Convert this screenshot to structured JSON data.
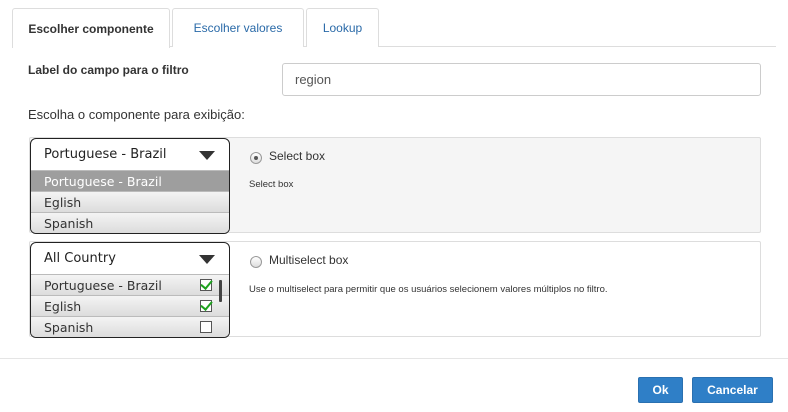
{
  "tabs": [
    {
      "label": "Escolher componente",
      "active": true
    },
    {
      "label": "Escolher valores",
      "active": false
    },
    {
      "label": "Lookup",
      "active": false
    }
  ],
  "filter_field": {
    "label": "Label do campo para o filtro",
    "value": "region"
  },
  "section_label": "Escolha o componente para exibição:",
  "select_box_option": {
    "title": "Select box",
    "description": "Select box",
    "selected": true,
    "preview": {
      "header": "Portuguese - Brazil",
      "items": [
        "Portuguese - Brazil",
        "Eglish",
        "Spanish"
      ],
      "highlighted_index": 0
    }
  },
  "multiselect_option": {
    "title": "Multiselect box",
    "description": "Use o multiselect para permitir que os usuários selecionem valores múltiplos no filtro.",
    "selected": false,
    "preview": {
      "header": "All Country",
      "items": [
        {
          "label": "Portuguese - Brazil",
          "checked": true
        },
        {
          "label": "Eglish",
          "checked": true
        },
        {
          "label": "Spanish",
          "checked": false
        }
      ]
    }
  },
  "buttons": {
    "ok": "Ok",
    "cancel": "Cancelar"
  },
  "colors": {
    "primary": "#2f7fc7",
    "link": "#2a6aa8",
    "check": "#1fa31f"
  }
}
